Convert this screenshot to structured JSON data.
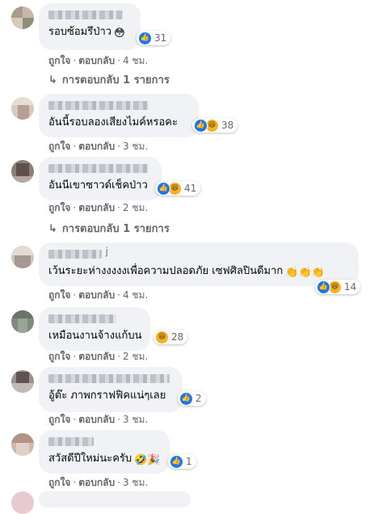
{
  "colors": {
    "like": "#1877f2",
    "haha": "#f7b125",
    "muted": "#65676b",
    "bubble": "#f0f2f5"
  },
  "labels": {
    "like": "ถูกใจ",
    "reply": "ตอบกลับ",
    "dot": "·"
  },
  "comments": [
    {
      "text": "รอบซ้อมรึป่าว",
      "inline_emoji": "😳",
      "reactions": [
        "like-icon"
      ],
      "count": "31",
      "time": "4 ชม.",
      "replies": "การตอบกลับ 1 รายการ"
    },
    {
      "text": "อันนี้รอบลองเสียงไมค์หรอคะ",
      "reactions": [
        "like-icon",
        "haha-icon"
      ],
      "count": "38",
      "time": "3 ชม."
    },
    {
      "text": "อันนีเขาซาวด์เช็คป่าว",
      "reactions": [
        "like-icon",
        "haha-icon"
      ],
      "count": "41",
      "time": "2 ชม.",
      "replies": "การตอบกลับ 1 รายการ"
    },
    {
      "name_suffix": "j",
      "text": "เว้นระยะห่างงงงงเพื่อความปลอดภัย เซฟศิลปินดีมาก",
      "inline_emoji": "👏👏👏",
      "reactions": [
        "like-icon",
        "haha-icon"
      ],
      "count": "14",
      "time": "4 ชม."
    },
    {
      "text": "เหมือนงานจ้างแก้บน",
      "reactions": [
        "haha-icon"
      ],
      "count": "28",
      "time": "2 ชม."
    },
    {
      "text": "อู้ต๊ะ ภาพกราฟฟิคแน่ๆเลย",
      "reactions": [
        "like-icon"
      ],
      "count": "2",
      "time": "3 ชม."
    },
    {
      "text": "สวัสดีปีใหม่นะครับ",
      "inline_emoji": "🤣🎉",
      "reactions": [
        "like-icon"
      ],
      "count": "1",
      "time": "3 ชม."
    }
  ]
}
